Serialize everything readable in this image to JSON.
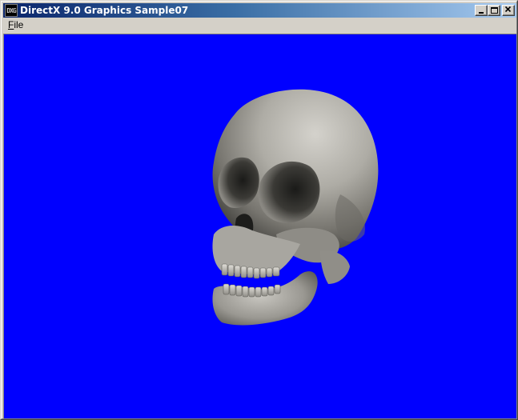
{
  "window": {
    "title": "DirectX 9.0 Graphics Sample07",
    "icon_label": "DXG",
    "icon_name": "directx-app-icon"
  },
  "caption_buttons": {
    "minimize": "minimize-icon",
    "maximize": "maximize-icon",
    "close": "close-icon"
  },
  "menu": {
    "items": [
      {
        "label_accel": "F",
        "label_rest": "ile"
      }
    ]
  },
  "viewport": {
    "background_color": "#0000ff",
    "content": "skull-3d-model"
  },
  "colors": {
    "title_gradient_start": "#0a246a",
    "title_gradient_end": "#a6caf0",
    "chrome": "#d4d0c8",
    "skull_base": "#b8b6b0"
  }
}
